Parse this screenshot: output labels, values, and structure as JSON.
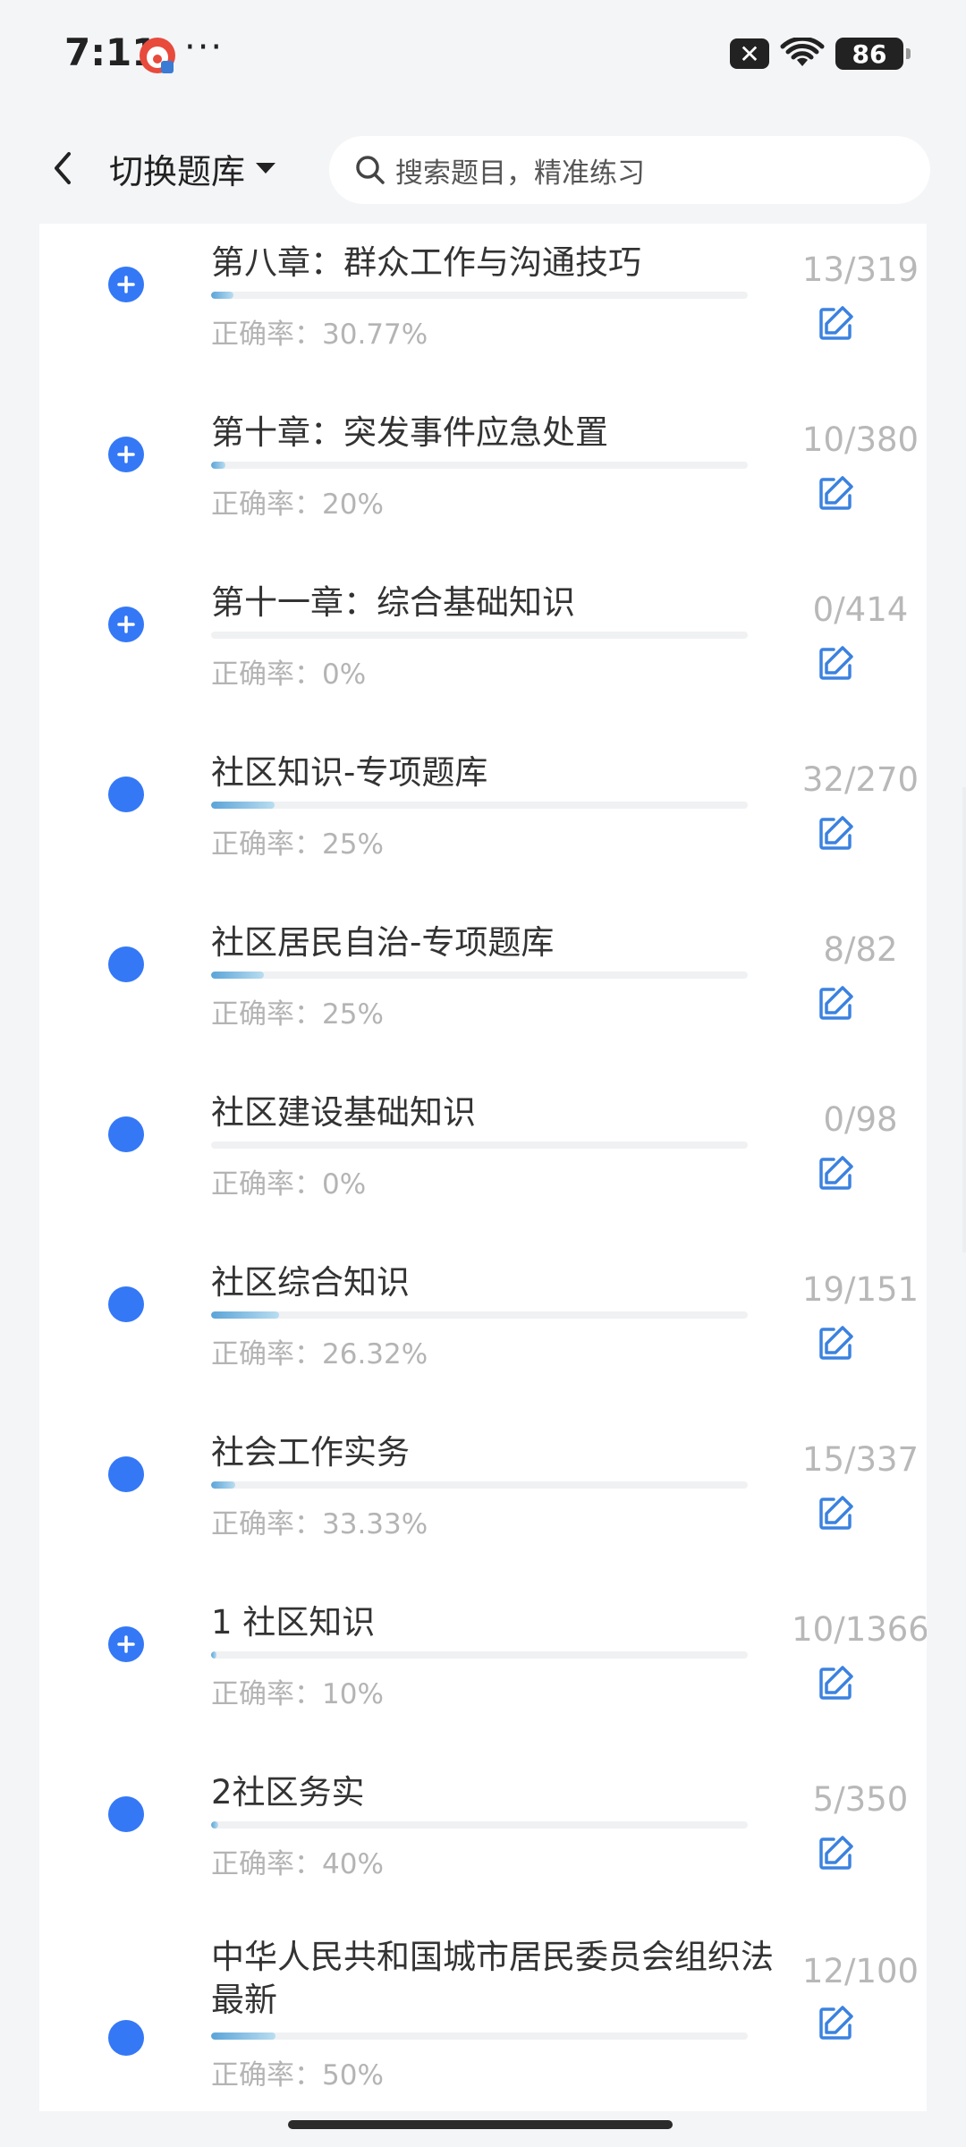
{
  "status_bar": {
    "time": "7:11",
    "more": "···",
    "mute_icon": "x-box-icon",
    "battery": "86"
  },
  "header": {
    "switch_label": "切换题库",
    "search_placeholder": "搜索题目，精准练习"
  },
  "colors": {
    "accent": "#3478f6",
    "edit_icon": "#3b82e0",
    "muted_text": "#b4b4b4"
  },
  "chapters": [
    {
      "title": "第八章：群众工作与沟通技巧",
      "rate": "正确率：30.77%",
      "count": "13/319",
      "progress": 0.041,
      "marker": "plus"
    },
    {
      "title": "第十章：突发事件应急处置",
      "rate": "正确率：20%",
      "count": "10/380",
      "progress": 0.026,
      "marker": "plus"
    },
    {
      "title": "第十一章：综合基础知识",
      "rate": "正确率：0%",
      "count": "0/414",
      "progress": 0.0,
      "marker": "plus"
    },
    {
      "title": "社区知识-专项题库",
      "rate": "正确率：25%",
      "count": "32/270",
      "progress": 0.119,
      "marker": "dot"
    },
    {
      "title": "社区居民自治-专项题库",
      "rate": "正确率：25%",
      "count": "8/82",
      "progress": 0.098,
      "marker": "dot"
    },
    {
      "title": "社区建设基础知识",
      "rate": "正确率：0%",
      "count": "0/98",
      "progress": 0.0,
      "marker": "dot"
    },
    {
      "title": "社区综合知识",
      "rate": "正确率：26.32%",
      "count": "19/151",
      "progress": 0.126,
      "marker": "dot"
    },
    {
      "title": "社会工作实务",
      "rate": "正确率：33.33%",
      "count": "15/337",
      "progress": 0.045,
      "marker": "dot"
    },
    {
      "title": "1 社区知识",
      "rate": "正确率：10%",
      "count": "10/1366",
      "progress": 0.007,
      "marker": "plus"
    },
    {
      "title": "2社区务实",
      "rate": "正确率：40%",
      "count": "5/350",
      "progress": 0.014,
      "marker": "dot"
    },
    {
      "title": "中华人民共和国城市居民委员会组织法 最新",
      "rate": "正确率：50%",
      "count": "12/100",
      "progress": 0.12,
      "marker": "dot"
    }
  ]
}
